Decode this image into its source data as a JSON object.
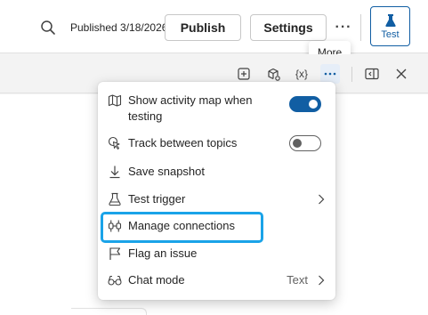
{
  "header": {
    "published_text": "Published 3/18/2026",
    "publish_label": "Publish",
    "settings_label": "Settings",
    "more_label": "···",
    "test_label": "Test"
  },
  "tooltip": {
    "text": "More"
  },
  "toolbar": {
    "icons": [
      "add-node-icon",
      "settings-cube-icon",
      "variables-icon",
      "more-icon",
      "panel-icon",
      "close-icon"
    ],
    "variables_label": "{x}"
  },
  "menu": {
    "items": [
      {
        "label_line1": "Show activity map when",
        "label_line2": "testing",
        "icon": "map-icon",
        "toggle": "on"
      },
      {
        "label": "Track between topics",
        "icon": "pointer-icon",
        "toggle": "off"
      },
      {
        "label": "Save snapshot",
        "icon": "download-icon"
      },
      {
        "label": "Test trigger",
        "icon": "flask-icon",
        "submenu": true
      },
      {
        "label": "Manage connections",
        "icon": "plug-connect-icon",
        "highlighted": true
      },
      {
        "label": "Flag an issue",
        "icon": "flag-icon"
      },
      {
        "label": "Chat mode",
        "icon": "glasses-icon",
        "value": "Text",
        "submenu": true
      }
    ]
  },
  "colors": {
    "accent": "#115ea3",
    "highlight": "#1aa3e8"
  }
}
